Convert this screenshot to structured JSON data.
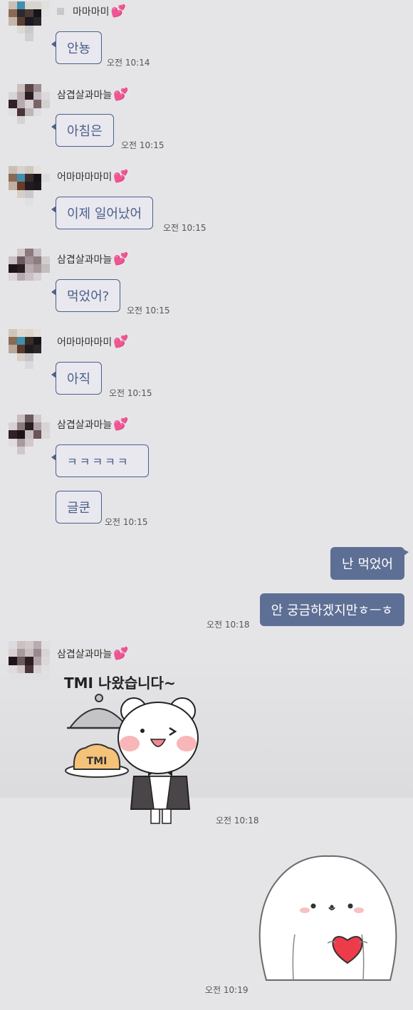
{
  "users": {
    "mama": {
      "name": "마마마미"
    },
    "mama2": {
      "name": "어마마마마미"
    },
    "samgyeop": {
      "name": "삼겹살과마늘"
    }
  },
  "name_emoji": "💕",
  "messages": [
    {
      "sender": "마마마미",
      "text": "안뇽",
      "time": "오전 10:14"
    },
    {
      "sender": "삼겹살과마늘",
      "text": "아침은",
      "time": "오전 10:15"
    },
    {
      "sender": "어마마마마미",
      "text": "이제 일어났어",
      "time": "오전 10:15"
    },
    {
      "sender": "삼겹살과마늘",
      "text": "먹었어?",
      "time": "오전 10:15"
    },
    {
      "sender": "어마마마마미",
      "text": "아직",
      "time": "오전 10:15"
    },
    {
      "sender": "삼겹살과마늘",
      "text": "ㅋㅋㅋㅋㅋ",
      "time": ""
    },
    {
      "sender": "삼겹살과마늘",
      "text": "글쿤",
      "time": "오전 10:15"
    },
    {
      "sender": "me",
      "text": "난 먹었어",
      "time": ""
    },
    {
      "sender": "me",
      "text": "안 궁금하겠지만ㅎㅡㅎ",
      "time": "오전 10:18"
    },
    {
      "sender": "삼겹살과마늘",
      "sticker": "tmi-bear-sticker",
      "sticker_title": "TMI 나왔습니다~",
      "sticker_label": "TMI",
      "time": "오전 10:18"
    },
    {
      "sender": "me",
      "sticker": "bunny-heart-sticker",
      "time": "오전 10:19"
    }
  ],
  "colors": {
    "background": "#e5e5e8",
    "incoming_border": "#4c5f8d",
    "outgoing_bubble": "#5e6f95",
    "heart": "#f34aa0"
  }
}
